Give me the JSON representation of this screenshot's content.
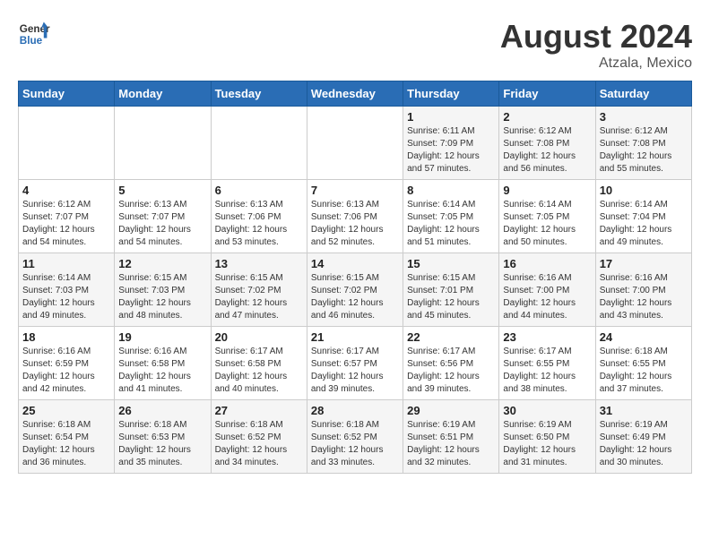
{
  "logo": {
    "line1": "General",
    "line2": "Blue"
  },
  "title": "August 2024",
  "location": "Atzala, Mexico",
  "days_of_week": [
    "Sunday",
    "Monday",
    "Tuesday",
    "Wednesday",
    "Thursday",
    "Friday",
    "Saturday"
  ],
  "weeks": [
    [
      {
        "day": "",
        "info": ""
      },
      {
        "day": "",
        "info": ""
      },
      {
        "day": "",
        "info": ""
      },
      {
        "day": "",
        "info": ""
      },
      {
        "day": "1",
        "info": "Sunrise: 6:11 AM\nSunset: 7:09 PM\nDaylight: 12 hours\nand 57 minutes."
      },
      {
        "day": "2",
        "info": "Sunrise: 6:12 AM\nSunset: 7:08 PM\nDaylight: 12 hours\nand 56 minutes."
      },
      {
        "day": "3",
        "info": "Sunrise: 6:12 AM\nSunset: 7:08 PM\nDaylight: 12 hours\nand 55 minutes."
      }
    ],
    [
      {
        "day": "4",
        "info": "Sunrise: 6:12 AM\nSunset: 7:07 PM\nDaylight: 12 hours\nand 54 minutes."
      },
      {
        "day": "5",
        "info": "Sunrise: 6:13 AM\nSunset: 7:07 PM\nDaylight: 12 hours\nand 54 minutes."
      },
      {
        "day": "6",
        "info": "Sunrise: 6:13 AM\nSunset: 7:06 PM\nDaylight: 12 hours\nand 53 minutes."
      },
      {
        "day": "7",
        "info": "Sunrise: 6:13 AM\nSunset: 7:06 PM\nDaylight: 12 hours\nand 52 minutes."
      },
      {
        "day": "8",
        "info": "Sunrise: 6:14 AM\nSunset: 7:05 PM\nDaylight: 12 hours\nand 51 minutes."
      },
      {
        "day": "9",
        "info": "Sunrise: 6:14 AM\nSunset: 7:05 PM\nDaylight: 12 hours\nand 50 minutes."
      },
      {
        "day": "10",
        "info": "Sunrise: 6:14 AM\nSunset: 7:04 PM\nDaylight: 12 hours\nand 49 minutes."
      }
    ],
    [
      {
        "day": "11",
        "info": "Sunrise: 6:14 AM\nSunset: 7:03 PM\nDaylight: 12 hours\nand 49 minutes."
      },
      {
        "day": "12",
        "info": "Sunrise: 6:15 AM\nSunset: 7:03 PM\nDaylight: 12 hours\nand 48 minutes."
      },
      {
        "day": "13",
        "info": "Sunrise: 6:15 AM\nSunset: 7:02 PM\nDaylight: 12 hours\nand 47 minutes."
      },
      {
        "day": "14",
        "info": "Sunrise: 6:15 AM\nSunset: 7:02 PM\nDaylight: 12 hours\nand 46 minutes."
      },
      {
        "day": "15",
        "info": "Sunrise: 6:15 AM\nSunset: 7:01 PM\nDaylight: 12 hours\nand 45 minutes."
      },
      {
        "day": "16",
        "info": "Sunrise: 6:16 AM\nSunset: 7:00 PM\nDaylight: 12 hours\nand 44 minutes."
      },
      {
        "day": "17",
        "info": "Sunrise: 6:16 AM\nSunset: 7:00 PM\nDaylight: 12 hours\nand 43 minutes."
      }
    ],
    [
      {
        "day": "18",
        "info": "Sunrise: 6:16 AM\nSunset: 6:59 PM\nDaylight: 12 hours\nand 42 minutes."
      },
      {
        "day": "19",
        "info": "Sunrise: 6:16 AM\nSunset: 6:58 PM\nDaylight: 12 hours\nand 41 minutes."
      },
      {
        "day": "20",
        "info": "Sunrise: 6:17 AM\nSunset: 6:58 PM\nDaylight: 12 hours\nand 40 minutes."
      },
      {
        "day": "21",
        "info": "Sunrise: 6:17 AM\nSunset: 6:57 PM\nDaylight: 12 hours\nand 39 minutes."
      },
      {
        "day": "22",
        "info": "Sunrise: 6:17 AM\nSunset: 6:56 PM\nDaylight: 12 hours\nand 39 minutes."
      },
      {
        "day": "23",
        "info": "Sunrise: 6:17 AM\nSunset: 6:55 PM\nDaylight: 12 hours\nand 38 minutes."
      },
      {
        "day": "24",
        "info": "Sunrise: 6:18 AM\nSunset: 6:55 PM\nDaylight: 12 hours\nand 37 minutes."
      }
    ],
    [
      {
        "day": "25",
        "info": "Sunrise: 6:18 AM\nSunset: 6:54 PM\nDaylight: 12 hours\nand 36 minutes."
      },
      {
        "day": "26",
        "info": "Sunrise: 6:18 AM\nSunset: 6:53 PM\nDaylight: 12 hours\nand 35 minutes."
      },
      {
        "day": "27",
        "info": "Sunrise: 6:18 AM\nSunset: 6:52 PM\nDaylight: 12 hours\nand 34 minutes."
      },
      {
        "day": "28",
        "info": "Sunrise: 6:18 AM\nSunset: 6:52 PM\nDaylight: 12 hours\nand 33 minutes."
      },
      {
        "day": "29",
        "info": "Sunrise: 6:19 AM\nSunset: 6:51 PM\nDaylight: 12 hours\nand 32 minutes."
      },
      {
        "day": "30",
        "info": "Sunrise: 6:19 AM\nSunset: 6:50 PM\nDaylight: 12 hours\nand 31 minutes."
      },
      {
        "day": "31",
        "info": "Sunrise: 6:19 AM\nSunset: 6:49 PM\nDaylight: 12 hours\nand 30 minutes."
      }
    ]
  ]
}
